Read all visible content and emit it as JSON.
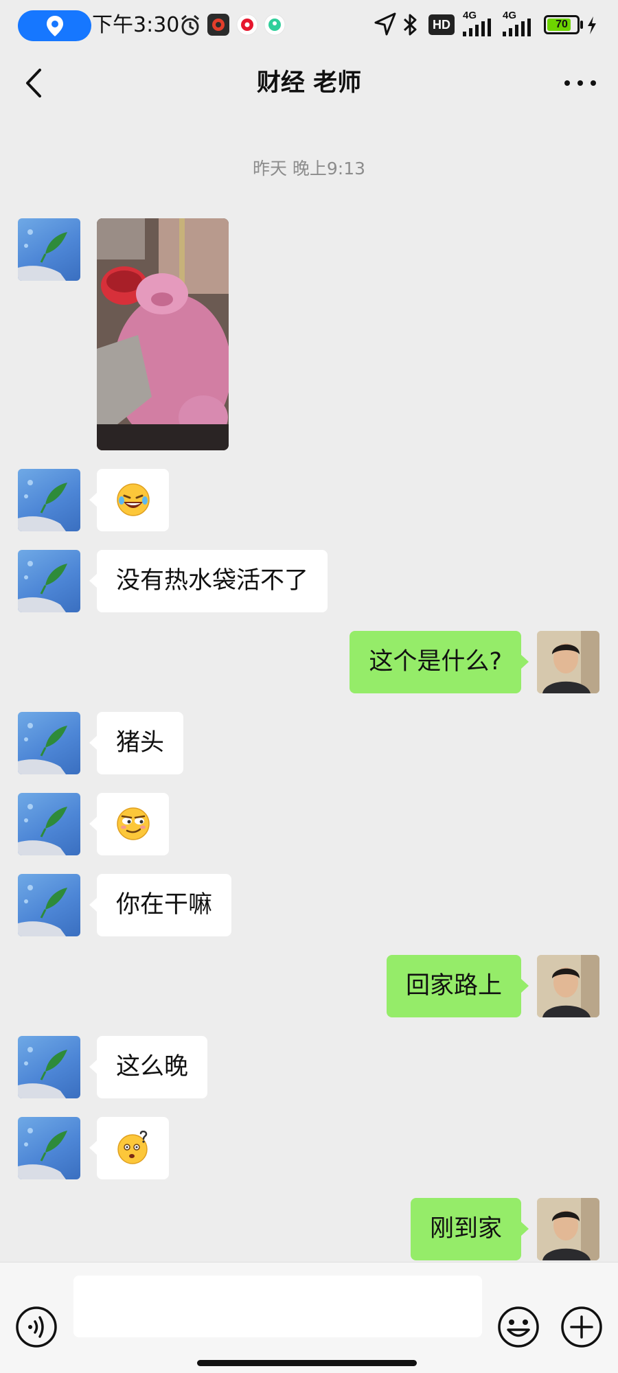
{
  "status_bar": {
    "time": "下午3:30",
    "network_1": "4G",
    "network_2": "4G",
    "hd_label": "HD",
    "battery": "70",
    "icons": [
      "location-pill-icon",
      "alarm-icon",
      "app-icon-netease",
      "app-icon-weibo",
      "app-icon-green",
      "navigation-arrow-icon",
      "bluetooth-icon",
      "hd-icon",
      "signal-icon",
      "signal-icon",
      "battery-icon",
      "charging-icon"
    ]
  },
  "nav": {
    "title": "财经 老师",
    "back_icon": "chevron-left-icon",
    "more_icon": "more-dots-icon"
  },
  "timestamp": "昨天 晚上9:13",
  "messages": [
    {
      "side": "left",
      "type": "image",
      "image": "pink-pig-plush-photo"
    },
    {
      "side": "left",
      "type": "emoji",
      "emoji": "laughing-tears-emoji"
    },
    {
      "side": "left",
      "type": "text",
      "text": "没有热水袋活不了"
    },
    {
      "side": "right",
      "type": "text",
      "text": "这个是什么?"
    },
    {
      "side": "left",
      "type": "text",
      "text": "猪头"
    },
    {
      "side": "left",
      "type": "emoji",
      "emoji": "smirk-emoji"
    },
    {
      "side": "left",
      "type": "text",
      "text": "你在干嘛"
    },
    {
      "side": "right",
      "type": "text",
      "text": "回家路上"
    },
    {
      "side": "left",
      "type": "text",
      "text": "这么晚"
    },
    {
      "side": "left",
      "type": "emoji",
      "emoji": "puzzled-emoji"
    },
    {
      "side": "right",
      "type": "text",
      "text": "刚到家"
    }
  ],
  "input_bar": {
    "value": "",
    "voice_icon": "voice-icon",
    "emoji_icon": "emoji-icon",
    "plus_icon": "plus-icon"
  },
  "colors": {
    "background": "#ededed",
    "bubble_left": "#ffffff",
    "bubble_right": "#95ec69",
    "location_pill": "#1677ff",
    "battery_fill": "#6dd400"
  }
}
